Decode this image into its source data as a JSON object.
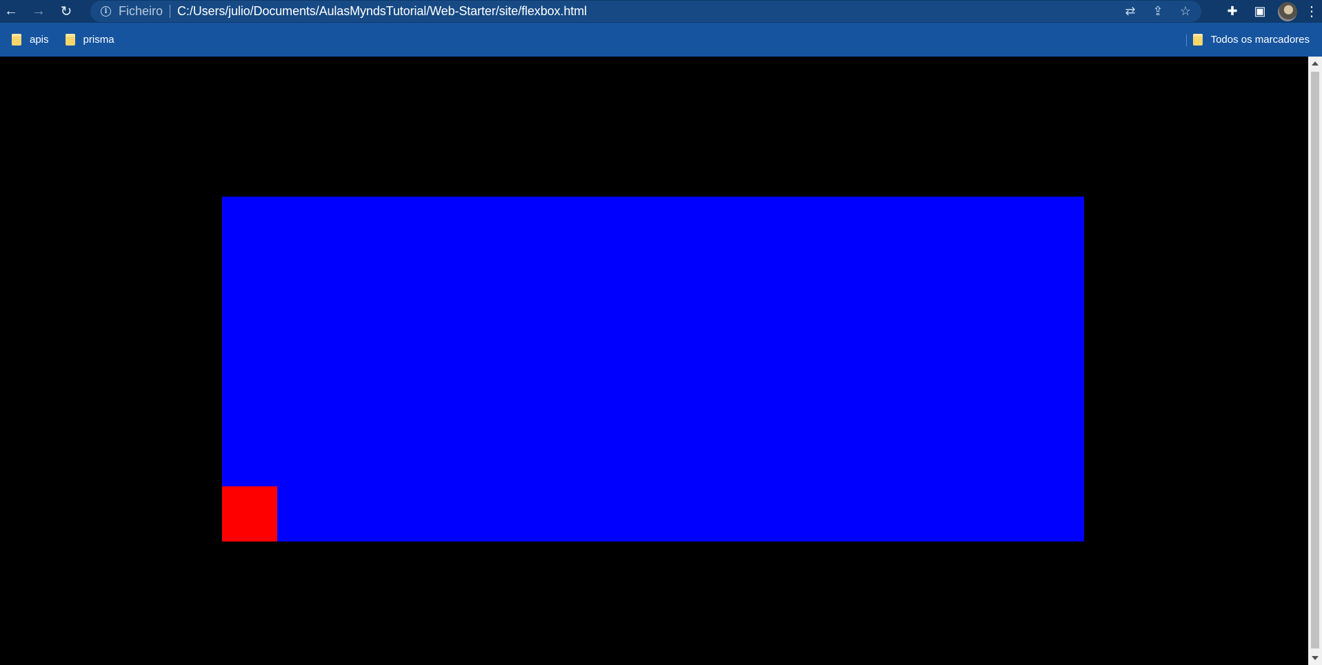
{
  "toolbar": {
    "back_icon": "arrow-left-icon",
    "forward_icon": "arrow-right-icon",
    "reload_icon": "reload-icon",
    "scheme_label": "Ficheiro",
    "url": "C:/Users/julio/Documents/AulasMyndsTutorial/Web-Starter/site/flexbox.html",
    "omnibox_icons": [
      "translate-icon",
      "share-icon",
      "star-icon"
    ],
    "right_icons": [
      "extensions-icon",
      "side-panel-icon",
      "avatar",
      "menu-icon"
    ]
  },
  "bookmarks": {
    "items": [
      {
        "label": "apis",
        "icon": "folder-icon"
      },
      {
        "label": "prisma",
        "icon": "folder-icon"
      }
    ],
    "all_bookmarks_label": "Todos os marcadores"
  },
  "page": {
    "background": "#000000",
    "container_color": "#0000ff",
    "child_color": "#ff0000"
  }
}
